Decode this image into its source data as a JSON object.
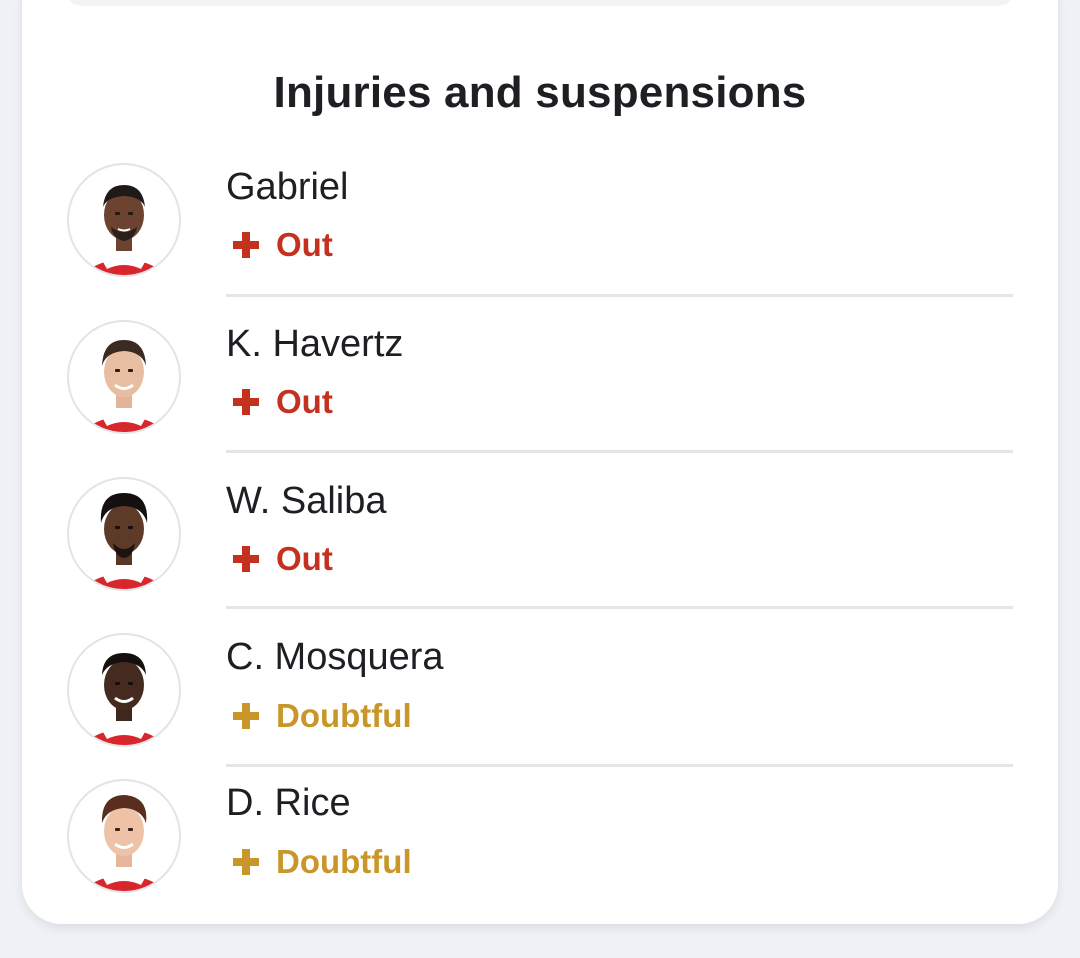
{
  "section": {
    "title": "Injuries and suspensions"
  },
  "colors": {
    "out": "#c4321f",
    "doubtful": "#c9962a",
    "text": "#1d1f23",
    "divider": "#e3e5e9"
  },
  "players": [
    {
      "name": "Gabriel",
      "status": "Out",
      "status_type": "out",
      "icon": "medical-cross-icon"
    },
    {
      "name": "K. Havertz",
      "status": "Out",
      "status_type": "out",
      "icon": "medical-cross-icon"
    },
    {
      "name": "W. Saliba",
      "status": "Out",
      "status_type": "out",
      "icon": "medical-cross-icon"
    },
    {
      "name": "C. Mosquera",
      "status": "Doubtful",
      "status_type": "doubtful",
      "icon": "medical-cross-icon"
    },
    {
      "name": "D. Rice",
      "status": "Doubtful",
      "status_type": "doubtful",
      "icon": "medical-cross-icon"
    }
  ]
}
